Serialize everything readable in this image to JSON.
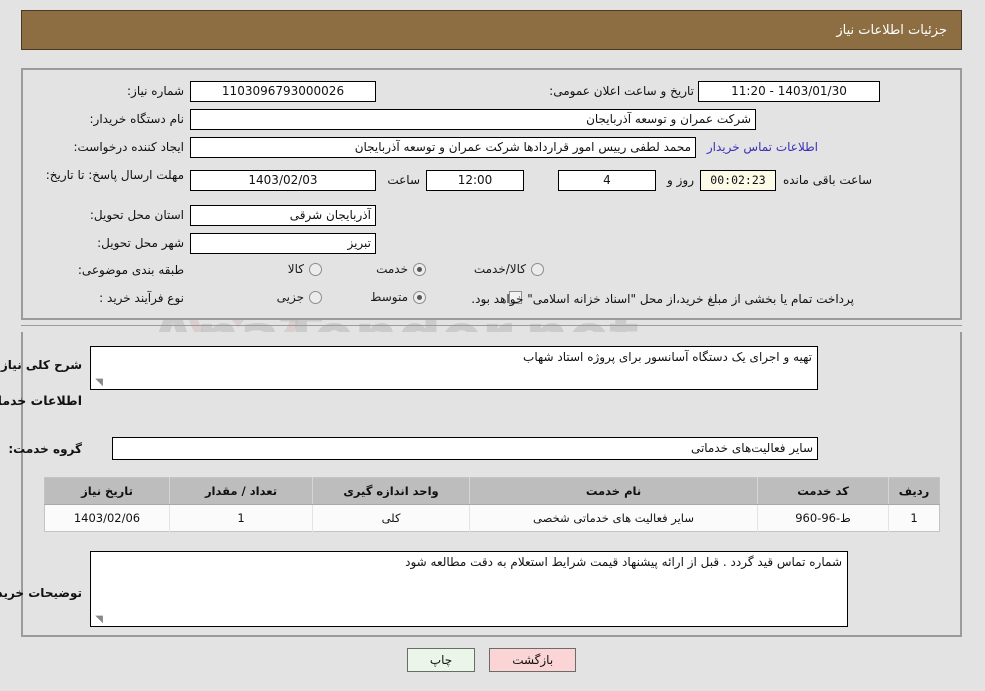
{
  "header": {
    "title": "جزئیات اطلاعات نیاز"
  },
  "top_section": {
    "need_number_label": "شماره نیاز:",
    "need_number_value": "1103096793000026",
    "announce_datetime_label": "تاریخ و ساعت اعلان عمومی:",
    "announce_datetime_value": "1403/01/30 - 11:20",
    "buyer_org_label": "نام دستگاه خریدار:",
    "buyer_org_value": "شرکت عمران و توسعه آذربایجان",
    "creator_label": "ایجاد کننده درخواست:",
    "creator_value": "محمد لطفی رییس امور قراردادها شرکت عمران و توسعه آذربایجان",
    "buyer_contact_link": "اطلاعات تماس خریدار",
    "deadline_label": "مهلت ارسال پاسخ: تا تاریخ:",
    "deadline_date": "1403/02/03",
    "deadline_hour_label": "ساعت",
    "deadline_hour_value": "12:00",
    "remaining_days_value": "4",
    "remaining_days_unit": "روز و",
    "remaining_timer_value": "00:02:23",
    "remaining_suffix": "ساعت باقی مانده",
    "province_label": "استان محل تحویل:",
    "province_value": "آذربایجان شرقی",
    "city_label": "شهر محل تحویل:",
    "city_value": "تبریز",
    "category_label": "طبقه بندی موضوعی:",
    "category_options": [
      {
        "label": "کالا",
        "selected": false
      },
      {
        "label": "خدمت",
        "selected": true
      },
      {
        "label": "کالا/خدمت",
        "selected": false
      }
    ],
    "process_label": "نوع فرآیند خرید :",
    "process_options": [
      {
        "label": "جزیی",
        "selected": false
      },
      {
        "label": "متوسط",
        "selected": true
      }
    ],
    "treasury_checkbox_checked": false,
    "treasury_note": "پرداخت تمام یا بخشی از مبلغ خرید،از محل \"اسناد خزانه اسلامی\" خواهد بود."
  },
  "bottom_section": {
    "need_desc_label": "شرح کلی نیاز:",
    "need_desc_value": "تهیه و اجرای یک دستگاه آسانسور برای پروژه استاد شهاب",
    "services_heading": "اطلاعات خدمات مورد نیاز",
    "service_group_label": "گروه خدمت:",
    "service_group_value": "سایر فعالیت‌های خدماتی",
    "buyer_notes_label": "توضیحات خریدار:",
    "buyer_notes_value": "شماره تماس قید گردد . قبل از ارائه پیشنهاد قیمت شرایط استعلام به دقت مطالعه شود"
  },
  "table": {
    "columns": [
      "ردیف",
      "کد خدمت",
      "نام خدمت",
      "واحد اندازه گیری",
      "تعداد / مقدار",
      "تاریخ نیاز"
    ],
    "rows": [
      {
        "row_no": "1",
        "service_code": "ط-96-960",
        "service_name": "سایر فعالیت های خدماتی شخصی",
        "unit": "کلی",
        "quantity": "1",
        "need_date": "1403/02/06"
      }
    ]
  },
  "buttons": {
    "print": "چاپ",
    "back": "بازگشت"
  },
  "watermark": {
    "text": "AnaTender.net"
  },
  "colors": {
    "header_bg": "#8d6e42",
    "page_bg": "#e3e3e3",
    "link": "#3b2fb5",
    "timer_bg": "#fbfbe8",
    "btn_print_bg": "#eaf6e8",
    "btn_back_bg": "#fbd5d5",
    "table_header_bg": "#bdbdbd"
  }
}
